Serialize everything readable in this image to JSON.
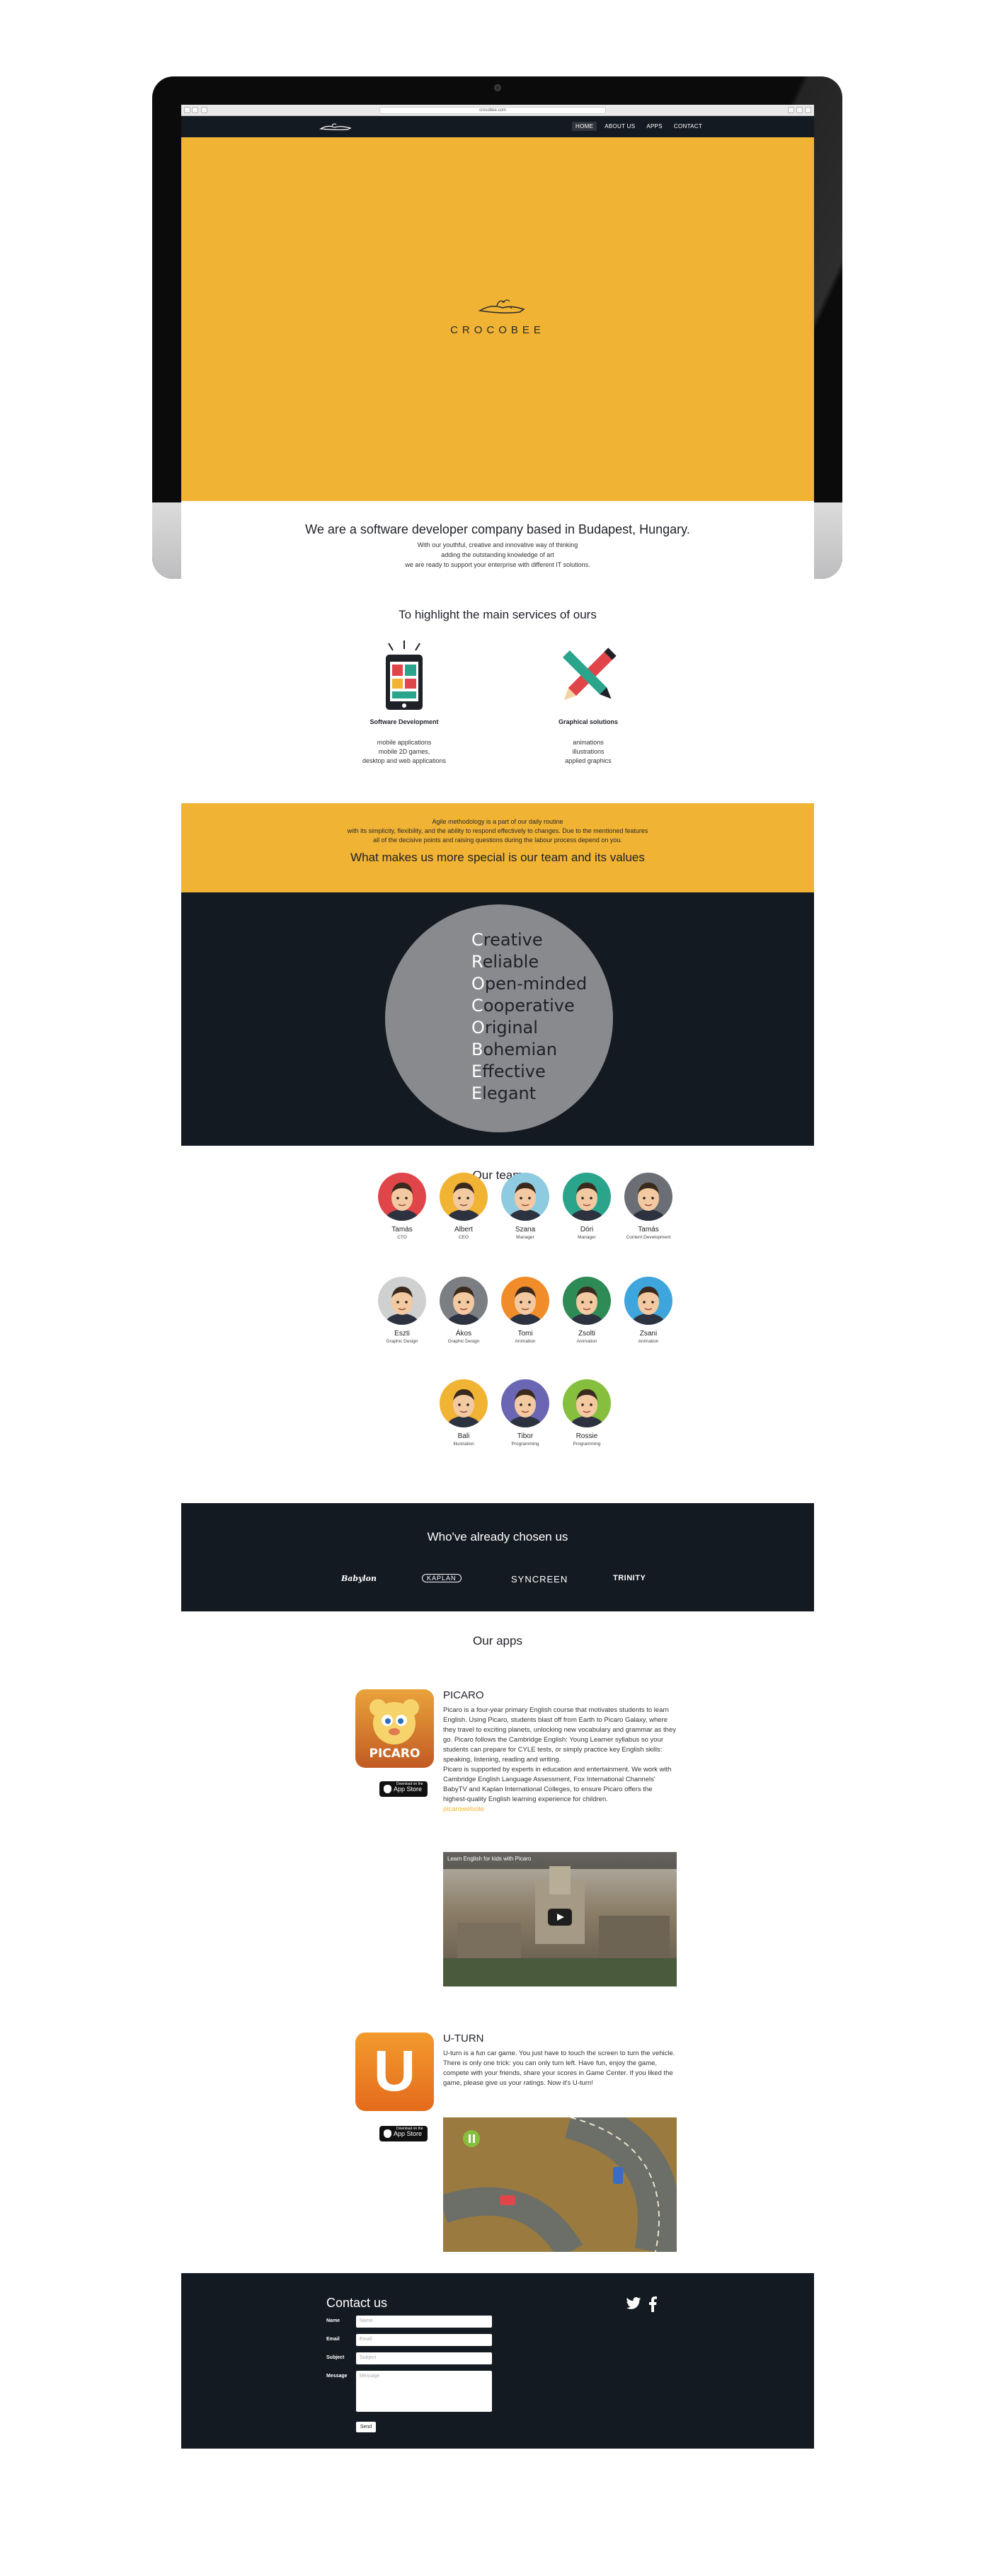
{
  "browser": {
    "url": "crocobee.com"
  },
  "nav": {
    "items": [
      {
        "label": "HOME"
      },
      {
        "label": "ABOUT US"
      },
      {
        "label": "APPS"
      },
      {
        "label": "CONTACT"
      }
    ]
  },
  "hero": {
    "brand": "CROCOBEE"
  },
  "intro": {
    "heading": "We are a software developer company based in Budapest, Hungary.",
    "lines": [
      "With our youthful, creative and innovative way of thinking",
      "adding the outstanding knowledge of art",
      "we are ready to support your enterprise with different IT solutions."
    ]
  },
  "services": {
    "title": "To highlight the main services of ours",
    "items": [
      {
        "title": "Software Development",
        "lines": [
          "mobile applications",
          "mobile 2D games,",
          "desktop and web applications"
        ]
      },
      {
        "title": "Graphical solutions",
        "lines": [
          "animations",
          "illustrations",
          "applied graphics"
        ]
      }
    ]
  },
  "agile": {
    "lines": [
      "Agile methodology is a part of our daily routine",
      "with its simplicity, flexibility, and the ability to respond effectively to changes. Due to the mentioned features",
      "all of the decisive points and raising questions during the labour process depend on you."
    ],
    "heading": "What makes us more special is our team and its values"
  },
  "values": [
    {
      "first": "C",
      "rest": "reative"
    },
    {
      "first": "R",
      "rest": "eliable"
    },
    {
      "first": "O",
      "rest": "pen-minded"
    },
    {
      "first": "C",
      "rest": "ooperative"
    },
    {
      "first": "O",
      "rest": "riginal"
    },
    {
      "first": "B",
      "rest": "ohemian"
    },
    {
      "first": "E",
      "rest": "ffective"
    },
    {
      "first": "E",
      "rest": "legant"
    }
  ],
  "team": {
    "title": "Our team",
    "members": [
      {
        "name": "Tamás",
        "role": "CTO",
        "color": "#e0454a"
      },
      {
        "name": "Albert",
        "role": "CEO",
        "color": "#f0b334"
      },
      {
        "name": "Szana",
        "role": "Manager",
        "color": "#8fcbe0"
      },
      {
        "name": "Dóri",
        "role": "Manager",
        "color": "#2aa58b"
      },
      {
        "name": "Tamás",
        "role": "Content Development",
        "color": "#6b6f75"
      },
      {
        "name": "Eszti",
        "role": "Graphic Design",
        "color": "#cfd0d0"
      },
      {
        "name": "Ákos",
        "role": "Graphic Design",
        "color": "#7b7e82"
      },
      {
        "name": "Tomi",
        "role": "Animation",
        "color": "#f08c2a"
      },
      {
        "name": "Zsolti",
        "role": "Animation",
        "color": "#2e8b55"
      },
      {
        "name": "Zsani",
        "role": "Animation",
        "color": "#3ea6dd"
      },
      {
        "name": "Bali",
        "role": "Illustration",
        "color": "#f0b334"
      },
      {
        "name": "Tibor",
        "role": "Programming",
        "color": "#6a66b3"
      },
      {
        "name": "Rossie",
        "role": "Programming",
        "color": "#86be3d"
      }
    ]
  },
  "clients": {
    "title": "Who've already chosen us",
    "logos": [
      "Babylon",
      "KAPLAN",
      "SYNCREEN",
      "TRINITY"
    ]
  },
  "apps": {
    "title": "Our apps",
    "store_label": "App Store",
    "store_small": "Download on the",
    "items": [
      {
        "name": "PICARO",
        "icon_text": "PICARO",
        "text": "Picaro is a four-year primary English course that motivates students to learn English. Using Picaro, students blast off from Earth to Picaro Galaxy, where they travel to exciting planets, unlocking new vocabulary and grammar as they go. Picaro follows the Cambridge English: Young Learner syllabus so your students can prepare for CYLE tests, or simply practice key English skills: speaking, listening, reading and writing.",
        "text2": "Picaro is supported by experts in education and entertainment. We work with Cambridge English Language Assessment, Fox International Channels' BabyTV and Kaplan International Colleges, to ensure Picaro offers the highest-quality English learning experience for children.",
        "link": "picarowebsite",
        "video_title": "Learn English for kids with Picaro"
      },
      {
        "name": "U-TURN",
        "icon_text": "U",
        "text": "U-turn is a fun car game. You just have to touch the screen to turn the vehicle. There is only one trick: you can only turn left. Have fun, enjoy the game, compete with your friends, share your scores in Game Center. If you liked the game, please give us your ratings. Now it's U-turn!"
      }
    ]
  },
  "contact": {
    "title": "Contact us",
    "fields": [
      {
        "label": "Name",
        "placeholder": "Name"
      },
      {
        "label": "Email",
        "placeholder": "Email"
      },
      {
        "label": "Subject",
        "placeholder": "Subject"
      },
      {
        "label": "Message",
        "placeholder": "Message"
      }
    ],
    "send": "Send"
  },
  "colors": {
    "accent": "#f0b334",
    "dark": "#141a21",
    "circle": "#898a8e"
  }
}
